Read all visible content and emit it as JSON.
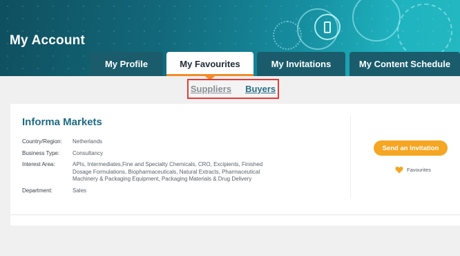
{
  "header": {
    "title": "My Account"
  },
  "tabs": [
    {
      "label": "My Profile",
      "active": false
    },
    {
      "label": "My Favourites",
      "active": true
    },
    {
      "label": "My Invitations",
      "active": false
    },
    {
      "label": "My Content Schedule",
      "active": false
    }
  ],
  "subtabs": {
    "suppliers": "Suppliers",
    "buyers": "Buyers"
  },
  "card": {
    "company": "Informa Markets",
    "fields": [
      {
        "label": "Country/Region:",
        "value": "Netherlands"
      },
      {
        "label": "Business Type:",
        "value": "Consultancy"
      },
      {
        "label": "Interest Area:",
        "value": "APIs, Intermediates,Fine and Specialty Chemicals, CRO, Excipients, Finished Dosage Formulations, Biopharmaceuticals, Natural Extracts, Pharmaceutical Machinery & Packaging Equipment, Packaging Materials & Drug Delivery"
      },
      {
        "label": "Department:",
        "value": "Sales"
      }
    ],
    "invite_label": "Send an Invitation",
    "favourite_label": "Favourites"
  },
  "colors": {
    "accent": "#f5a623",
    "tab_bg": "#1a5c6c",
    "company_text": "#1d6b84",
    "highlight_border": "#e53935",
    "heart": "#f5a623"
  },
  "icons": [
    "phone-icon",
    "heart-icon"
  ]
}
